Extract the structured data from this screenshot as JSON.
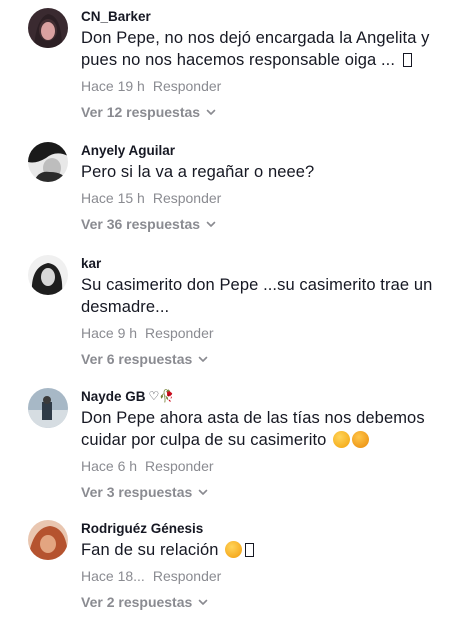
{
  "comments": [
    {
      "username": "CN_Barker",
      "badge": "",
      "text": "Don Pepe, no nos dejó encargada la Angelita y pues no nos hacemos responsable oiga ...",
      "time": "Hace 19 h",
      "reply_label": "Responder",
      "replies_label": "Ver 12 respuestas",
      "avatar_colors": [
        "#2a1f24",
        "#c97f8a"
      ]
    },
    {
      "username": "Anyely Aguilar",
      "badge": "",
      "text": "Pero si la va a regañar o neee?",
      "time": "Hace 15 h",
      "reply_label": "Responder",
      "replies_label": "Ver 36 respuestas",
      "avatar_colors": [
        "#1c1c1c",
        "#d9d9d9"
      ]
    },
    {
      "username": "kar",
      "badge": "",
      "text": "Su casimerito don Pepe ...su casimerito trae un desmadre...",
      "time": "Hace 9 h",
      "reply_label": "Responder",
      "replies_label": "Ver 6 respuestas",
      "avatar_colors": [
        "#e6e6e6",
        "#222222"
      ]
    },
    {
      "username": "Nayde GB",
      "badge": "♡🥀",
      "text": "Don Pepe ahora asta de las tías nos debemos cuidar por culpa de su casimerito",
      "time": "Hace 6 h",
      "reply_label": "Responder",
      "replies_label": "Ver 3 respuestas",
      "avatar_colors": [
        "#8fa4b4",
        "#2d3a46"
      ]
    },
    {
      "username": "Rodriguéz Génesis",
      "badge": "",
      "text": "Fan de su relación",
      "time": "Hace 18...",
      "reply_label": "Responder",
      "replies_label": "Ver 2 respuestas",
      "avatar_colors": [
        "#d48a5c",
        "#7b3b2a"
      ]
    }
  ],
  "icons": {
    "chevron": "chevron-down-icon",
    "emoji_smirk": "smirk-emoji-icon",
    "emoji_angry": "angry-emoji-icon",
    "emoji_love": "smiling-hearts-emoji-icon",
    "missing_glyph": "missing-glyph-icon"
  },
  "colors": {
    "text": "#161823",
    "muted": "#8a8b91",
    "background": "#ffffff"
  }
}
